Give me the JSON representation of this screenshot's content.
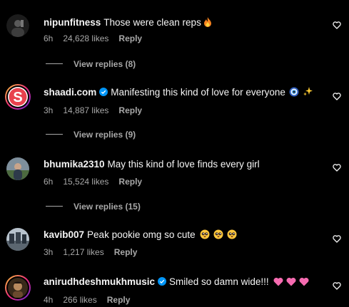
{
  "comments": [
    {
      "username": "nipunfitness",
      "verified": false,
      "text": "Those were clean reps",
      "emojis": [
        "fire"
      ],
      "time": "6h",
      "likes": "24,628 likes",
      "reply_label": "Reply",
      "view_replies": "View replies (8)"
    },
    {
      "username": "shaadi.com",
      "verified": true,
      "text": "Manifesting this kind of love for everyone",
      "emojis": [
        "nazar-amulet",
        "sparkles"
      ],
      "time": "3h",
      "likes": "14,887 likes",
      "reply_label": "Reply",
      "view_replies": "View replies (9)"
    },
    {
      "username": "bhumika2310",
      "verified": false,
      "text": "May this kind of love finds every girl",
      "emojis": [],
      "time": "6h",
      "likes": "15,524 likes",
      "reply_label": "Reply",
      "view_replies": "View replies (15)"
    },
    {
      "username": "kavib007",
      "verified": false,
      "text": "Peak pookie omg so cute",
      "emojis": [
        "pleading-face",
        "pleading-face",
        "pleading-face"
      ],
      "time": "3h",
      "likes": "1,217 likes",
      "reply_label": "Reply"
    },
    {
      "username": "anirudhdeshmukhmusic",
      "verified": true,
      "text": "Smiled so damn wide!!!",
      "emojis": [
        "pink-heart",
        "pink-heart",
        "pink-heart"
      ],
      "time": "4h",
      "likes": "266 likes",
      "reply_label": "Reply"
    }
  ],
  "colors": {
    "background": "#000000",
    "text": "#f5f5f5",
    "secondary": "#a8a8a8",
    "verified": "#0095f6",
    "shaadi_brand": "#e8424e",
    "pink_heart": "#f56bb0"
  }
}
